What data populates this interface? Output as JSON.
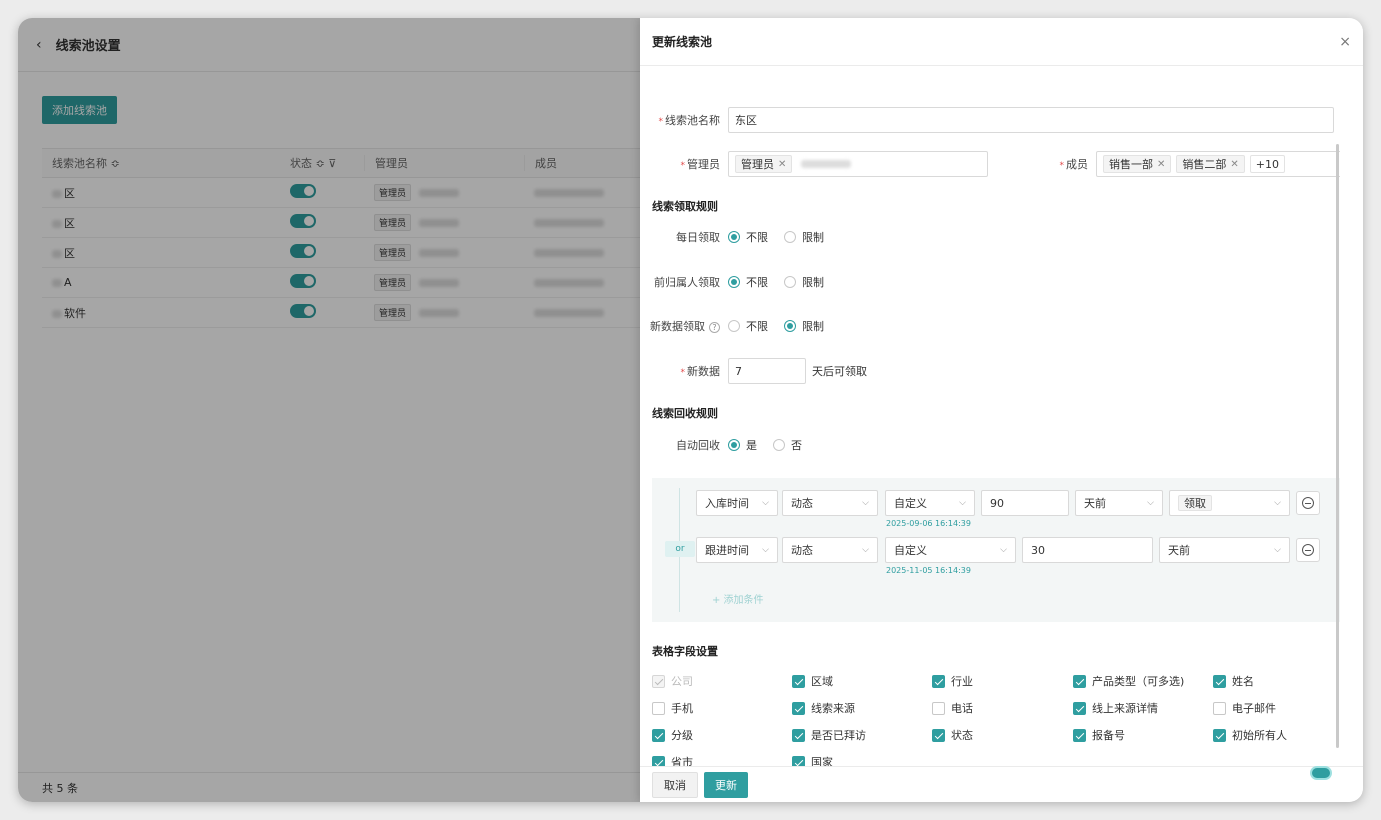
{
  "bg": {
    "back_icon": "‹",
    "title": "线索池设置",
    "add_button": "添加线索池",
    "columns": [
      "线索池名称 ≎",
      "状态 ≎ ⊽",
      "管理员",
      "成员"
    ],
    "rows": [
      {
        "name": "区",
        "admin_tag": "管理员"
      },
      {
        "name": "区",
        "admin_tag": "管理员"
      },
      {
        "name": "区",
        "admin_tag": "管理员"
      },
      {
        "name": "A",
        "admin_tag": "管理员"
      },
      {
        "name": "软件",
        "admin_tag": "管理员"
      }
    ],
    "total": "共 5 条"
  },
  "drawer": {
    "title": "更新线索池",
    "close": "×",
    "pool_name_label": "线索池名称",
    "pool_name_value": "东区",
    "admin_label": "管理员",
    "admin_tag": "管理员",
    "members_label": "成员",
    "member_tags": [
      "销售一部",
      "销售二部"
    ],
    "member_more": "+10",
    "claim_rules_title": "线索领取规则",
    "daily_claim_label": "每日领取",
    "prev_owner_label": "前归属人领取",
    "new_data_claim_label": "新数据领取",
    "opt_unlimited": "不限",
    "opt_limited": "限制",
    "new_data_label": "新数据",
    "new_data_value": "7",
    "new_data_suffix": "天后可领取",
    "recycle_title": "线索回收规则",
    "auto_recycle_label": "自动回收",
    "opt_yes": "是",
    "opt_no": "否",
    "or_badge": "or",
    "cond1": {
      "field": "入库时间",
      "mode": "动态",
      "range": "自定义",
      "value": "90",
      "unit": "天前",
      "action": "领取",
      "date": "2025-09-06 16:14:39"
    },
    "cond2": {
      "field": "跟进时间",
      "mode": "动态",
      "range": "自定义",
      "value": "30",
      "unit": "天前",
      "date": "2025-11-05 16:14:39"
    },
    "add_condition": "+ 添加条件",
    "fields_title": "表格字段设置",
    "fields": [
      {
        "label": "公司",
        "state": "disabled"
      },
      {
        "label": "区域",
        "state": "on"
      },
      {
        "label": "行业",
        "state": "on"
      },
      {
        "label": "产品类型（可多选)",
        "state": "on"
      },
      {
        "label": "姓名",
        "state": "on"
      },
      {
        "label": "手机",
        "state": "off"
      },
      {
        "label": "线索来源",
        "state": "on"
      },
      {
        "label": "电话",
        "state": "off"
      },
      {
        "label": "线上来源详情",
        "state": "on"
      },
      {
        "label": "电子邮件",
        "state": "off"
      },
      {
        "label": "分级",
        "state": "on"
      },
      {
        "label": "是否已拜访",
        "state": "on"
      },
      {
        "label": "状态",
        "state": "on"
      },
      {
        "label": "报备号",
        "state": "on"
      },
      {
        "label": "初始所有人",
        "state": "on"
      },
      {
        "label": "省市",
        "state": "on"
      },
      {
        "label": "国家",
        "state": "on"
      }
    ],
    "cancel_button": "取消",
    "update_button": "更新"
  }
}
